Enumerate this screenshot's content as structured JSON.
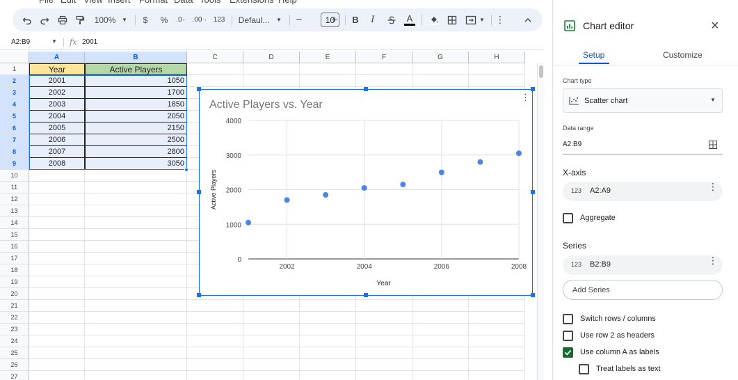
{
  "menu": [
    "File",
    "Edit",
    "View",
    "Insert",
    "Format",
    "Data",
    "Tools",
    "Extensions",
    "Help"
  ],
  "toolbar": {
    "zoom": "100%",
    "currency": "$",
    "percent": "%",
    "dec_decrease": ".0",
    "dec_increase": ".00",
    "number_format": "123",
    "font": "Defaul...",
    "font_size": "10",
    "bold": "B",
    "italic": "I",
    "text_color": "A"
  },
  "formula_bar": {
    "name_box": "A2:B9",
    "value": "2001"
  },
  "columns": [
    "A",
    "B",
    "C",
    "D",
    "E",
    "F",
    "G",
    "H"
  ],
  "rows": [
    "1",
    "2",
    "3",
    "4",
    "5",
    "6",
    "7",
    "8",
    "9",
    "10",
    "11",
    "12",
    "13",
    "14",
    "15",
    "16",
    "17",
    "18",
    "19",
    "20",
    "21",
    "22",
    "23",
    "24",
    "25",
    "26",
    "27"
  ],
  "sheet": {
    "header": [
      "Year",
      "Active Players"
    ],
    "data": [
      [
        "2001",
        "1050"
      ],
      [
        "2002",
        "1700"
      ],
      [
        "2003",
        "1850"
      ],
      [
        "2004",
        "2050"
      ],
      [
        "2005",
        "2150"
      ],
      [
        "2006",
        "2500"
      ],
      [
        "2007",
        "2800"
      ],
      [
        "2008",
        "3050"
      ]
    ]
  },
  "chart_data": {
    "type": "scatter",
    "title": "Active Players vs. Year",
    "xlabel": "Year",
    "ylabel": "Active Players",
    "x": [
      2001,
      2002,
      2003,
      2004,
      2005,
      2006,
      2007,
      2008
    ],
    "y": [
      1050,
      1700,
      1850,
      2050,
      2150,
      2500,
      2800,
      3050
    ],
    "xlim": [
      2001,
      2008
    ],
    "ylim": [
      0,
      4000
    ],
    "xticks": [
      2002,
      2004,
      2006,
      2008
    ],
    "yticks": [
      0,
      1000,
      2000,
      3000,
      4000
    ],
    "grid": true,
    "legend": "none",
    "color": "#4a86e8"
  },
  "panel": {
    "title": "Chart editor",
    "tabs": [
      "Setup",
      "Customize"
    ],
    "chart_type_label": "Chart type",
    "chart_type": "Scatter chart",
    "data_range_label": "Data range",
    "data_range": "A2:B9",
    "xaxis_label": "X-axis",
    "xaxis_range": "A2:A9",
    "aggregate": "Aggregate",
    "series_label": "Series",
    "series_range": "B2:B9",
    "add_series": "Add Series",
    "num_tag": "123",
    "options": {
      "switch": "Switch rows / columns",
      "row2_headers": "Use row 2 as headers",
      "colA_labels": "Use column A as labels",
      "treat_text": "Treat labels as text"
    }
  },
  "colors": {
    "accent": "#1a73e8",
    "header_yellow": "#ffe599",
    "header_green": "#b6d7a8",
    "selection": "#e8eefa"
  }
}
